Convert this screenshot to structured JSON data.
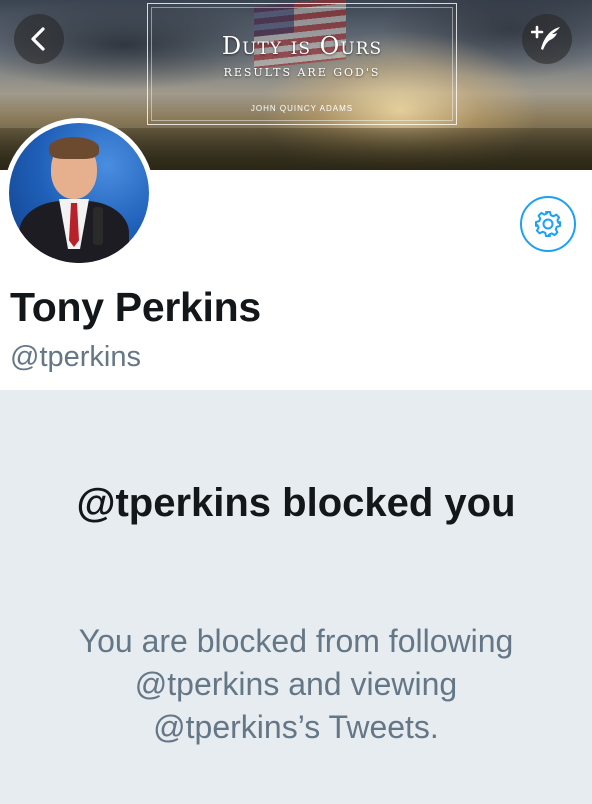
{
  "header": {
    "banner": {
      "title": "Duty is Ours",
      "subtitle": "RESULTS ARE GOD'S",
      "author": "JOHN QUINCY ADAMS"
    },
    "back_icon": "chevron-left-icon",
    "compose_icon": "compose-tweet-icon"
  },
  "profile": {
    "name": "Tony Perkins",
    "handle": "@tperkins",
    "settings_icon": "gear-icon"
  },
  "blocked": {
    "title": "@tperkins blocked you",
    "description": "You are blocked from following @tperkins and viewing @tperkins’s Tweets."
  },
  "colors": {
    "accent": "#1da1f2",
    "panel_bg": "#e6ecf0",
    "secondary_text": "#657786",
    "primary_text": "#14171a"
  }
}
